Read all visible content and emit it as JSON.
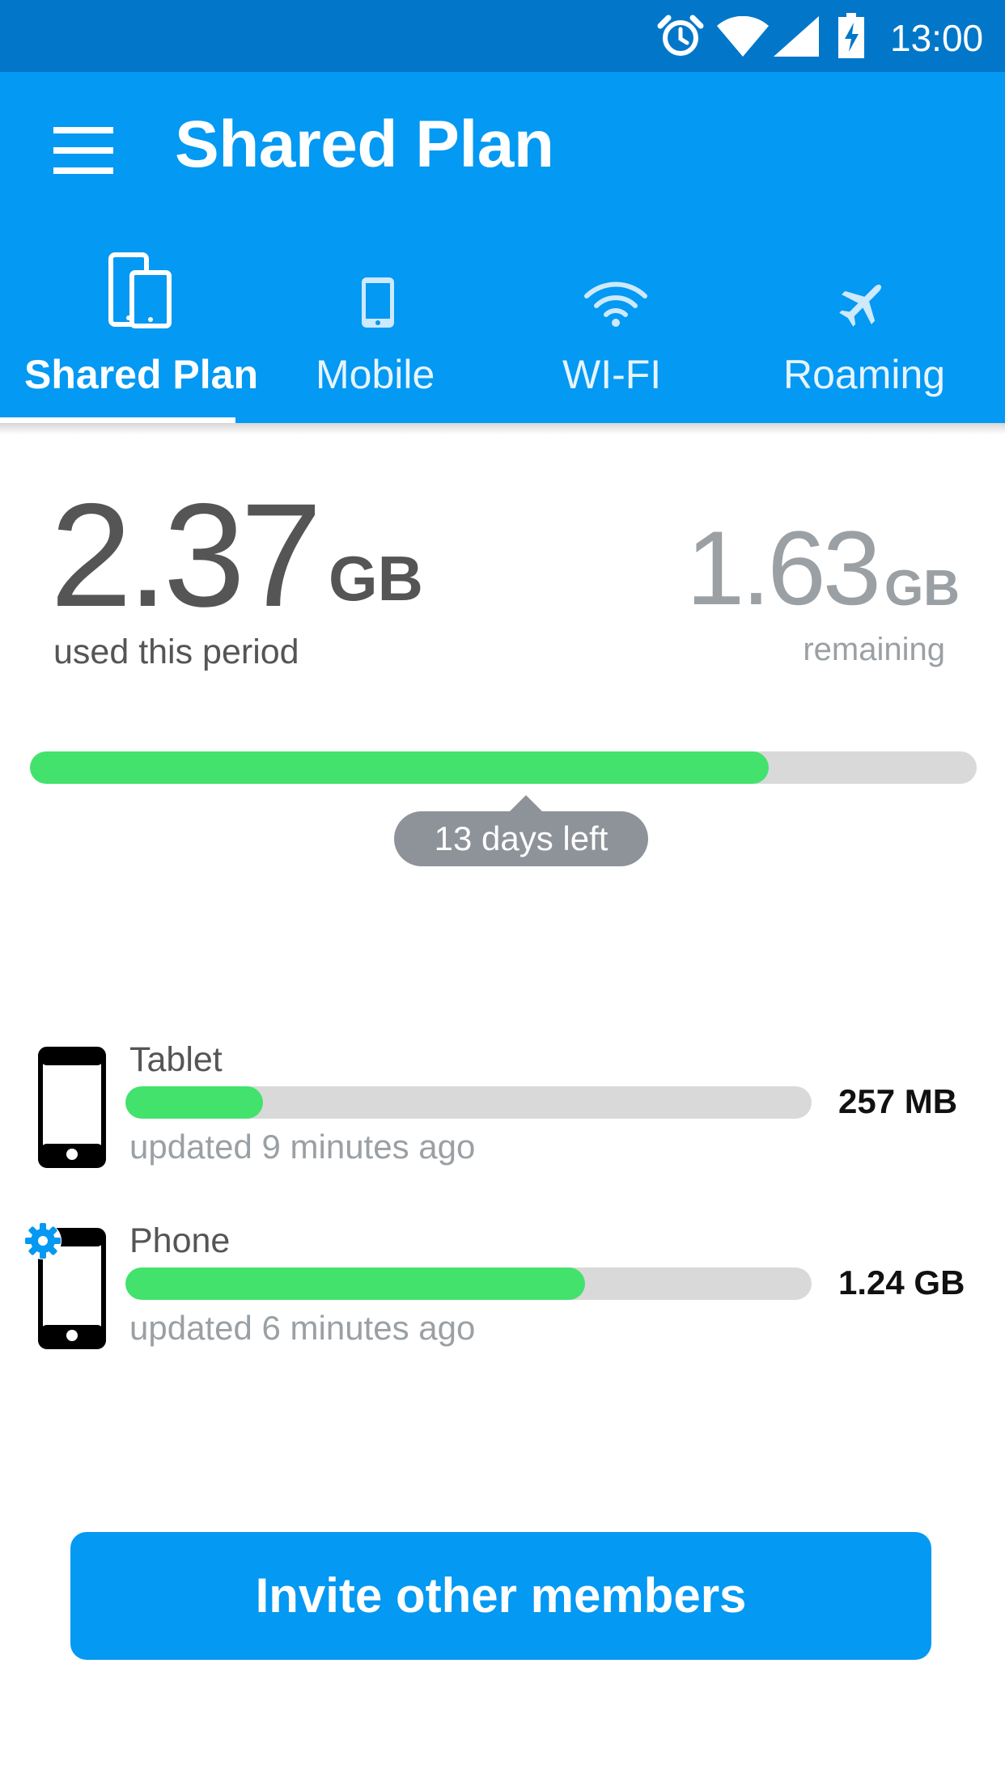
{
  "status_bar": {
    "time": "13:00",
    "icons": [
      "alarm-icon",
      "wifi-icon",
      "signal-icon",
      "battery-charging-icon"
    ]
  },
  "app_bar": {
    "menu_icon": "hamburger-menu-icon",
    "title": "Shared Plan"
  },
  "tabs": [
    {
      "label": "Shared Plan",
      "icon": "devices-icon",
      "active": true
    },
    {
      "label": "Mobile",
      "icon": "smartphone-icon",
      "active": false
    },
    {
      "label": "WI-FI",
      "icon": "wifi-icon",
      "active": false
    },
    {
      "label": "Roaming",
      "icon": "airplane-icon",
      "active": false
    }
  ],
  "usage": {
    "used_value": "2.37",
    "used_unit": "GB",
    "used_caption": "used this period",
    "remaining_value": "1.63",
    "remaining_unit": "GB",
    "remaining_caption": "remaining",
    "progress_fraction": 0.78,
    "days_left": "13 days left"
  },
  "devices": [
    {
      "name": "Tablet",
      "updated": "updated 9 minutes ago",
      "amount": "257 MB",
      "progress_fraction": 0.2,
      "icon": "phone-outline-icon"
    },
    {
      "name": "Phone",
      "updated": "updated 6 minutes ago",
      "amount": "1.24 GB",
      "progress_fraction": 0.67,
      "icon": "phone-outline-icon",
      "badge_icon": "gear-icon"
    }
  ],
  "invite_button": {
    "label": "Invite other members"
  },
  "colors": {
    "status_bar": "#0277c9",
    "app_bar": "#0499f2",
    "progress_fill": "#43e26c",
    "progress_track": "#d9d9d9",
    "tooltip": "#8e9399",
    "text_dark": "#555555",
    "text_muted": "#9aa0a4"
  }
}
